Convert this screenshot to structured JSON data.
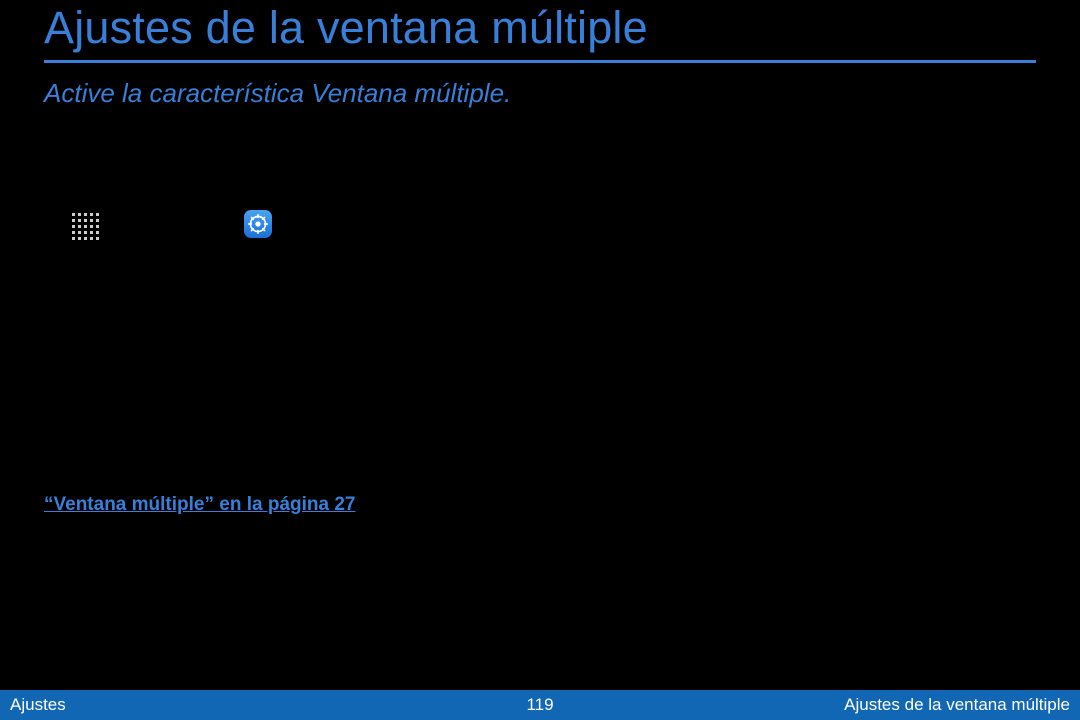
{
  "title": "Ajustes de la ventana múltiple",
  "subtitle": "Active la característica Ventana múltiple.",
  "icons": {
    "apps": "apps-grid-icon",
    "settings": "settings-gear-icon"
  },
  "link": "“Ventana múltiple” en la página 27",
  "footer": {
    "left": "Ajustes",
    "page": "119",
    "right": "Ajustes de la ventana múltiple"
  }
}
